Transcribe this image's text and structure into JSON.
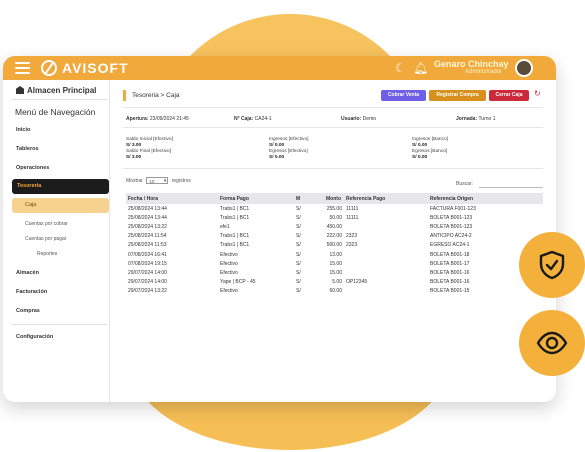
{
  "app": {
    "brand": "AVISOFT",
    "user_name": "Genaro Chinchay",
    "user_role": "Administrador"
  },
  "sidebar": {
    "header": "Almacen Principal",
    "nav_title": "Menú de Navegación",
    "items": {
      "inicio": "Inicio",
      "tableros": "Tableros",
      "operaciones": "Operaciones",
      "tesoreria": "Tesoreria",
      "caja": "Caja",
      "cuentas_cobrar": "Cuentas por cobrar",
      "cuentas_pagar": "Cuentas por pagar",
      "reportes": "Reportes",
      "almacen": "Almacén",
      "facturacion": "Facturación",
      "compras": "Compras",
      "configuracion": "Configuración"
    }
  },
  "main": {
    "breadcrumb": "Tesoreria > Caja",
    "buttons": {
      "cobrar_venta": "Cobrar Venta",
      "registrar_compra": "Registrar Compra",
      "cerrar_caja": "Cerrar Caja"
    },
    "info": {
      "apertura_label": "Apertura:",
      "apertura_value": "23/09/2024 21:45",
      "caja_label": "N° Caja:",
      "caja_value": "CA24-1",
      "usuario_label": "Usuario:",
      "usuario_value": "Demo",
      "jornada_label": "Jornada:",
      "jornada_value": "Turno 1"
    },
    "amounts": {
      "saldo_inicial_label": "Saldo Inicial [Efectivo]",
      "saldo_inicial_value": "S/ 3.00",
      "saldo_final_label": "Saldo Final [Efectivo]",
      "saldo_final_value": "S/ 3.00",
      "ingresos_efectivo_label": "Ingresos [Efectivo]",
      "ingresos_efectivo_value": "S/ 0.00",
      "egresos_efectivo_label": "Egresos [Efectivo]",
      "egresos_efectivo_value": "S/ 0.00",
      "ingresos_banco_label": "Ingresos [Banco]",
      "ingresos_banco_value": "S/ 0.00",
      "egresos_banco_label": "Egresos [Banco]",
      "egresos_banco_value": "S/ 0.00"
    },
    "table_controls": {
      "mostrar": "Mostrar",
      "page_size": "10",
      "registros": "registros",
      "buscar": "Buscar:"
    },
    "table": {
      "headers": {
        "fecha": "Fecha / Hora",
        "forma_pago": "Forma Pago",
        "m": "M",
        "monto": "Monto",
        "ref_pago": "Referencia Pago",
        "ref_origen": "Referencia Origen"
      },
      "rows": [
        {
          "fecha": "25/08/2024 13:44",
          "forma": "Trabs1 | BC1",
          "m": "S/",
          "monto": "255.00",
          "ref_pago": "11111",
          "ref_origen": "FACTURA F001-123"
        },
        {
          "fecha": "25/08/2024 13:44",
          "forma": "Trabs1 | BC1",
          "m": "S/",
          "monto": "50.00",
          "ref_pago": "11111",
          "ref_origen": "BOLETA B001-123"
        },
        {
          "fecha": "25/08/2024 13:22",
          "forma": "efe1",
          "m": "S/",
          "monto": "450.00",
          "ref_pago": "",
          "ref_origen": "BOLETA B001-123"
        },
        {
          "fecha": "25/08/2024 11:54",
          "forma": "Trabs1 | BC1",
          "m": "S/",
          "monto": "222.00",
          "ref_pago": "2323",
          "ref_origen": "ANTICIPO AC24-2"
        },
        {
          "fecha": "25/08/2024 11:53",
          "forma": "Trabs1 | BC1",
          "m": "S/",
          "monto": "500.00",
          "ref_pago": "2323",
          "ref_origen": "EGRESO AC24-1"
        },
        {
          "fecha": "07/08/2024 16:41",
          "forma": "Efectivo",
          "m": "S/",
          "monto": "13.00",
          "ref_pago": "",
          "ref_origen": "BOLETA B001-18"
        },
        {
          "fecha": "07/08/2024 19:15",
          "forma": "Efectivo",
          "m": "S/",
          "monto": "15.00",
          "ref_pago": "",
          "ref_origen": "BOLETA B001-17"
        },
        {
          "fecha": "29/07/2024 14:00",
          "forma": "Efectivo",
          "m": "S/",
          "monto": "15.00",
          "ref_pago": "",
          "ref_origen": "BOLETA B001-16"
        },
        {
          "fecha": "29/07/2024 14:00",
          "forma": "Yape | BCP - 45",
          "m": "S/",
          "monto": "5.00",
          "ref_pago": "OP12345",
          "ref_origen": "BOLETA B001-16"
        },
        {
          "fecha": "29/07/2024 13:22",
          "forma": "Efectivo",
          "m": "S/",
          "monto": "60.00",
          "ref_pago": "",
          "ref_origen": "BOLETA B001-15"
        }
      ]
    }
  },
  "colors": {
    "accent": "#f0a93a",
    "blob": "#f6bd56",
    "active_bg": "#1c1c1c",
    "btn_venta": "#6f5ee8",
    "btn_compra": "#d8901c",
    "btn_cerrar": "#cc2a3a"
  },
  "icons": [
    "hamburger-icon",
    "logo-icon",
    "moon-icon",
    "bell-icon",
    "warehouse-icon",
    "refresh-icon",
    "shield-check-icon",
    "eye-icon"
  ]
}
